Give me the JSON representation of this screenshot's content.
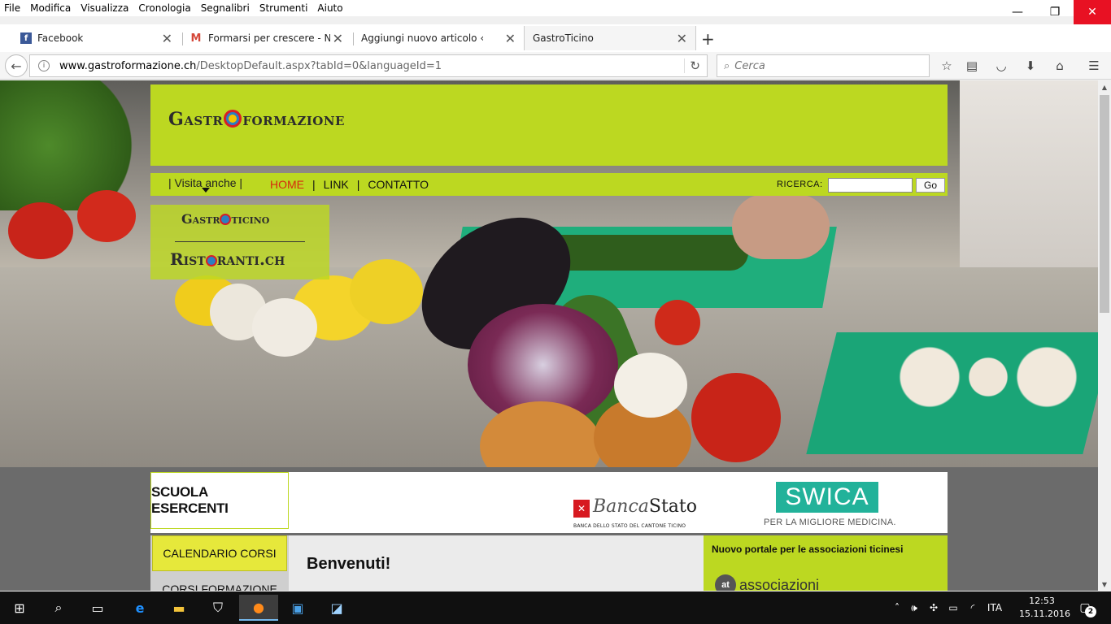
{
  "menubar": {
    "items": [
      "File",
      "Modifica",
      "Visualizza",
      "Cronologia",
      "Segnalibri",
      "Strumenti",
      "Aiuto"
    ]
  },
  "window": {
    "minimize_glyph": "—",
    "maximize_glyph": "❐",
    "close_glyph": "✕"
  },
  "tabs": [
    {
      "label": "Facebook",
      "icon": "facebook-icon"
    },
    {
      "label": "Formarsi per crescere - Ne...",
      "icon": "gmail-icon"
    },
    {
      "label": "Aggiungi nuovo articolo ‹ Etici...",
      "icon": "wordpress-icon"
    },
    {
      "label": "GastroTicino",
      "icon": "none"
    }
  ],
  "newtab_glyph": "+",
  "navbar": {
    "url_host": "www.gastroformazione.ch",
    "url_path": "/DesktopDefault.aspx?tabId=0&languageId=1",
    "search_placeholder": "Cerca"
  },
  "site": {
    "logo_prefix": "Gastr",
    "logo_suffix": "formazione",
    "nav": {
      "visita": "| Visita anche |",
      "home": "HOME",
      "sep": "|",
      "link": "LINK",
      "contatto": "CONTATTO",
      "ricerca": "RICERCA:",
      "go": "Go"
    },
    "dropdown": {
      "item1_prefix": "Gastr",
      "item1_suffix": "ticino",
      "item2_prefix": "Rist",
      "item2_suffix": "ranti.ch"
    },
    "sponsors": {
      "scuola": "SCUOLA ESERCENTI",
      "bancastato_banca": "Banca",
      "bancastato_stato": "Stato",
      "bancastato_sub": "BANCA DELLO STATO DEL CANTONE TICINO",
      "swica": "SWICA",
      "swica_sub": "PER LA MIGLIORE MEDICINA."
    },
    "content": {
      "calendario": "CALENDARIO CORSI",
      "corsi": "CORSI FORMAZIONE",
      "benvenuti": "Benvenuti!",
      "portal": "Nuovo portale per le associazioni ticinesi",
      "assoc": "associazioni"
    }
  },
  "taskbar": {
    "lang": "ITA",
    "time": "12:53",
    "date": "15.11.2016",
    "notif_count": "2"
  },
  "colors": {
    "accent_green": "#bcd821",
    "home_red": "#d62a0d",
    "swica_teal": "#22b29a",
    "bancastato_red": "#d71920"
  }
}
